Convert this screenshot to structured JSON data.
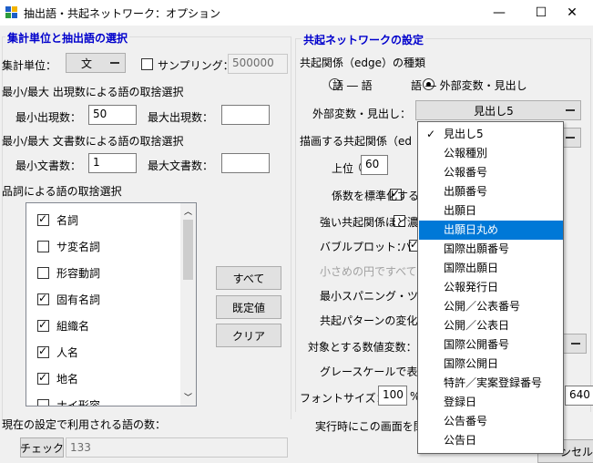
{
  "window": {
    "title": "抽出語・共起ネットワーク：オプション",
    "minimize_glyph": "—",
    "maximize_glyph": "☐",
    "close_glyph": "✕"
  },
  "left": {
    "group_title": "集計単位と抽出語の選択",
    "unit_label": "集計単位：",
    "unit_value": "文",
    "sampling_label": "サンプリング：",
    "sampling_checked": false,
    "sampling_value": "500000",
    "freq_heading": "最小/最大 出現数による語の取捨選択",
    "min_freq_label": "最小出現数：",
    "min_freq_value": "50",
    "max_freq_label": "最大出現数：",
    "max_freq_value": "",
    "doc_heading": "最小/最大 文書数による語の取捨選択",
    "min_doc_label": "最小文書数：",
    "min_doc_value": "1",
    "max_doc_label": "最大文書数：",
    "max_doc_value": "",
    "pos_heading": "品詞による語の取捨選択",
    "pos_items": [
      {
        "label": "名詞",
        "checked": true
      },
      {
        "label": "サ変名詞",
        "checked": false
      },
      {
        "label": "形容動詞",
        "checked": false
      },
      {
        "label": "固有名詞",
        "checked": true
      },
      {
        "label": "組織名",
        "checked": true
      },
      {
        "label": "人名",
        "checked": true
      },
      {
        "label": "地名",
        "checked": true
      },
      {
        "label": "ナイ形容",
        "checked": false
      }
    ],
    "all_button": "すべて",
    "default_button": "既定値",
    "clear_button": "クリア",
    "current_count_label": "現在の設定で利用される語の数：",
    "check_button": "チェック",
    "check_value": "133"
  },
  "right": {
    "group_title": "共起ネットワークの設定",
    "edge_type_label": "共起関係（edge）の種類",
    "radio_word_word": "語 ― 語",
    "radio_word_external": "語 ― 外部変数・見出し",
    "external_label": "外部変数・見出し：",
    "external_value": "見出し5",
    "draw_label": "描画する共起関係（ed",
    "top_label": "上位",
    "top_value": "60",
    "standardize_label": "係数を標準化する",
    "strong_label": "強い共起関係ほど濃",
    "bubble_label": "バブルプロット：",
    "bubble_suffix": "バ",
    "small_circle_label": "小さめの円ですべての",
    "min_span_label": "最小スパニング・ツリー",
    "pattern_label": "共起パターンの変化",
    "target_var_label": "対象とする数値変数：",
    "grayscale_label": "グレースケールで表現",
    "font_size_label": "フォントサイズ：",
    "font_size_value": "100",
    "font_size_unit": "%",
    "plot_size_value": "640",
    "run_label": "実行時にこの画面を閉",
    "cancel_partial": "ンセル"
  },
  "dropdown": {
    "items": [
      "見出し5",
      "公報種別",
      "公報番号",
      "出願番号",
      "出願日",
      "出願日丸め",
      "国際出願番号",
      "国際出願日",
      "公報発行日",
      "公開／公表番号",
      "公開／公表日",
      "国際公開番号",
      "国際公開日",
      "特許／実案登録番号",
      "登録日",
      "公告番号",
      "公告日"
    ],
    "checked_index": 0,
    "selected_index": 5
  },
  "colors": {
    "accent": "#0078d7",
    "group_title": "#0000cc"
  }
}
